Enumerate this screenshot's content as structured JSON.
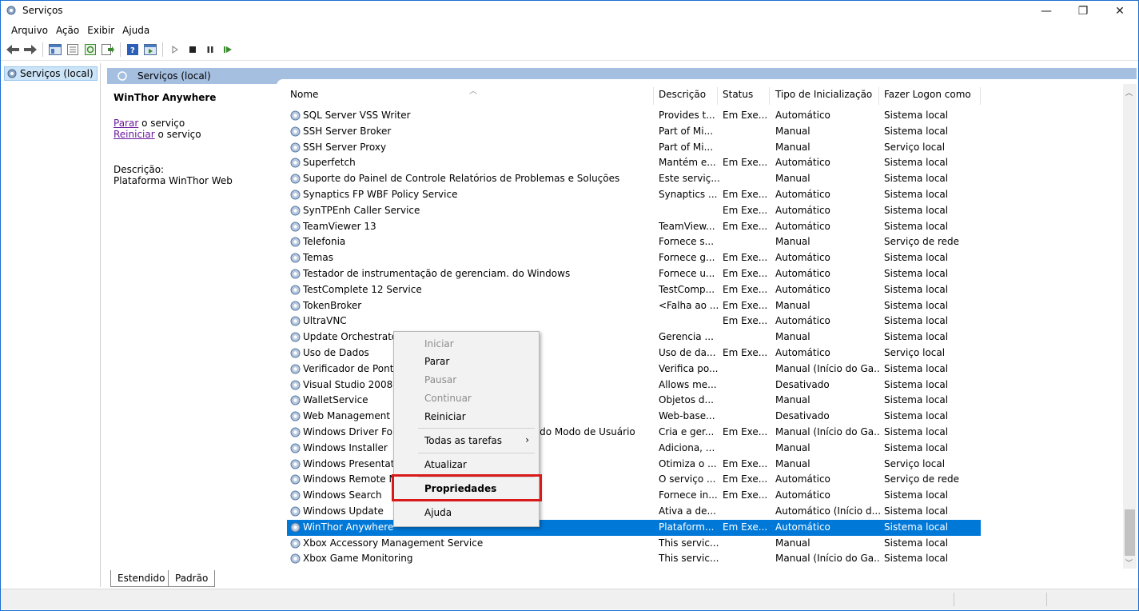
{
  "window": {
    "title": "Serviços",
    "min": "—",
    "max": "❐",
    "close": "✕"
  },
  "menu": [
    "Arquivo",
    "Ação",
    "Exibir",
    "Ajuda"
  ],
  "tree": {
    "root_label": "Serviços (local)"
  },
  "pane": {
    "header": "Serviços (local)"
  },
  "details": {
    "service_name": "WinThor Anywhere",
    "stop_link": "Parar",
    "stop_suffix": " o serviço",
    "restart_link": "Reiniciar",
    "restart_suffix": " o serviço",
    "desc_label": "Descrição:",
    "desc_text": "Plataforma WinThor Web"
  },
  "columns": {
    "name": "Nome",
    "desc": "Descrição",
    "status": "Status",
    "startup": "Tipo de Inicialização",
    "logon": "Fazer Logon como"
  },
  "rows": [
    {
      "name": "SQL Server VSS Writer",
      "desc": "Provides t...",
      "status": "Em Exe...",
      "startup": "Automático",
      "logon": "Sistema local"
    },
    {
      "name": "SSH Server Broker",
      "desc": "Part of Mi...",
      "status": "",
      "startup": "Manual",
      "logon": "Sistema local"
    },
    {
      "name": "SSH Server Proxy",
      "desc": "Part of Mi...",
      "status": "",
      "startup": "Manual",
      "logon": "Serviço local"
    },
    {
      "name": "Superfetch",
      "desc": "Mantém e...",
      "status": "Em Exe...",
      "startup": "Automático",
      "logon": "Sistema local"
    },
    {
      "name": "Suporte do Painel de Controle Relatórios de Problemas e Soluções",
      "desc": "Este serviç...",
      "status": "",
      "startup": "Manual",
      "logon": "Sistema local"
    },
    {
      "name": "Synaptics FP WBF Policy Service",
      "desc": "Synaptics ...",
      "status": "Em Exe...",
      "startup": "Automático",
      "logon": "Sistema local"
    },
    {
      "name": "SynTPEnh Caller Service",
      "desc": "",
      "status": "Em Exe...",
      "startup": "Automático",
      "logon": "Sistema local"
    },
    {
      "name": "TeamViewer 13",
      "desc": "TeamView...",
      "status": "Em Exe...",
      "startup": "Automático",
      "logon": "Sistema local"
    },
    {
      "name": "Telefonia",
      "desc": "Fornece s...",
      "status": "",
      "startup": "Manual",
      "logon": "Serviço de rede"
    },
    {
      "name": "Temas",
      "desc": "Fornece g...",
      "status": "Em Exe...",
      "startup": "Automático",
      "logon": "Sistema local"
    },
    {
      "name": "Testador de instrumentação de gerenciam. do Windows",
      "desc": "Fornece u...",
      "status": "Em Exe...",
      "startup": "Automático",
      "logon": "Sistema local"
    },
    {
      "name": "TestComplete 12 Service",
      "desc": "TestComp...",
      "status": "Em Exe...",
      "startup": "Automático",
      "logon": "Sistema local"
    },
    {
      "name": "TokenBroker",
      "desc": "<Falha ao ...",
      "status": "Em Exe...",
      "startup": "Manual",
      "logon": "Sistema local"
    },
    {
      "name": "UltraVNC",
      "desc": "",
      "status": "Em Exe...",
      "startup": "Automático",
      "logon": "Sistema local"
    },
    {
      "name": "Update Orchestrator Service",
      "desc": "Gerencia ...",
      "status": "",
      "startup": "Manual",
      "logon": "Sistema local"
    },
    {
      "name": "Uso de Dados",
      "desc": "Uso de da...",
      "status": "Em Exe...",
      "startup": "Automático",
      "logon": "Serviço local"
    },
    {
      "name": "Verificador de Ponto",
      "desc": "Verifica po...",
      "status": "",
      "startup": "Manual (Início do Ga...",
      "logon": "Sistema local"
    },
    {
      "name": "Visual Studio 2008 Remote Debugger",
      "desc": "Allows me...",
      "status": "",
      "startup": "Desativado",
      "logon": "Sistema local"
    },
    {
      "name": "WalletService",
      "desc": "Objetos d...",
      "status": "",
      "startup": "Manual",
      "logon": "Sistema local"
    },
    {
      "name": "Web Management",
      "desc": "Web-base...",
      "status": "",
      "startup": "Desativado",
      "logon": "Sistema local"
    },
    {
      "name": "Windows Driver Foundation - Estrutura de Driver do Modo de Usuário",
      "desc": "Cria e ger...",
      "status": "Em Exe...",
      "startup": "Manual (Início do Ga...",
      "logon": "Sistema local"
    },
    {
      "name": "Windows Installer",
      "desc": "Adiciona, ...",
      "status": "",
      "startup": "Manual",
      "logon": "Sistema local"
    },
    {
      "name": "Windows Presentation Foundation Font Cache",
      "desc": "Otimiza o ...",
      "status": "Em Exe...",
      "startup": "Manual",
      "logon": "Serviço local"
    },
    {
      "name": "Windows Remote Management",
      "desc": "O serviço ...",
      "status": "Em Exe...",
      "startup": "Automático",
      "logon": "Serviço de rede"
    },
    {
      "name": "Windows Search",
      "desc": "Fornece in...",
      "status": "Em Exe...",
      "startup": "Automático",
      "logon": "Sistema local"
    },
    {
      "name": "Windows Update",
      "desc": "Ativa a de...",
      "status": "",
      "startup": "Automático (Início d...",
      "logon": "Sistema local"
    },
    {
      "name": "WinThor Anywhere",
      "desc": "Plataform...",
      "status": "Em Exe...",
      "startup": "Automático",
      "logon": "Sistema local",
      "selected": true
    },
    {
      "name": "Xbox Accessory Management Service",
      "desc": "This servic...",
      "status": "",
      "startup": "Manual",
      "logon": "Sistema local"
    },
    {
      "name": "Xbox Game Monitoring",
      "desc": "This servic...",
      "status": "",
      "startup": "Manual (Início do Ga...",
      "logon": "Sistema local"
    }
  ],
  "context_menu": {
    "iniciar": "Iniciar",
    "parar": "Parar",
    "pausar": "Pausar",
    "continuar": "Continuar",
    "reiniciar": "Reiniciar",
    "todas": "Todas as tarefas",
    "todas_arrow": "›",
    "atualizar": "Atualizar",
    "propriedades": "Propriedades",
    "ajuda": "Ajuda"
  },
  "tabs": {
    "extended": "Estendido",
    "standard": "Padrão"
  },
  "colors": {
    "selection": "#0078d7",
    "header": "#a5bfe0",
    "highlight": "#d81a1a"
  }
}
